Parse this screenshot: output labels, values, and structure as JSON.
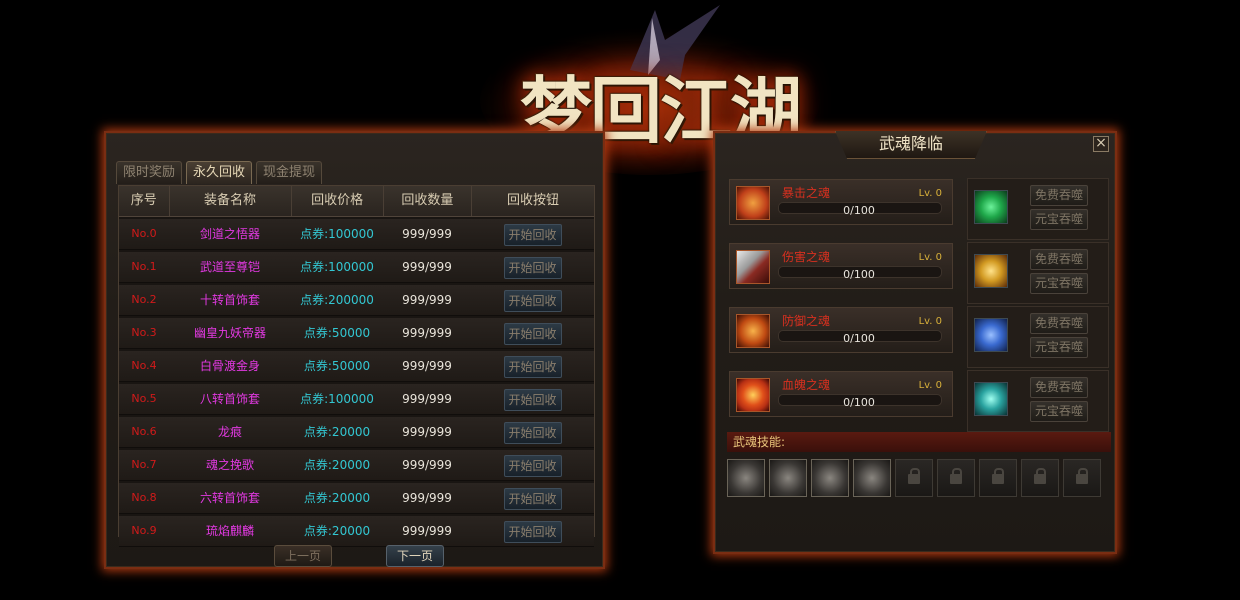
{
  "logo": {
    "text": "梦回江湖"
  },
  "left_panel": {
    "tabs": [
      {
        "label": "限时奖励",
        "active": false
      },
      {
        "label": "永久回收",
        "active": true
      },
      {
        "label": "现金提现",
        "active": false
      }
    ],
    "columns": [
      "序号",
      "装备名称",
      "回收价格",
      "回收数量",
      "回收按钮"
    ],
    "rows": [
      {
        "no": "No.0",
        "name": "剑道之悟器",
        "price": "点券:100000",
        "qty": "999/999",
        "button": "开始回收"
      },
      {
        "no": "No.1",
        "name": "武道至尊铠",
        "price": "点券:100000",
        "qty": "999/999",
        "button": "开始回收"
      },
      {
        "no": "No.2",
        "name": "十转首饰套",
        "price": "点券:200000",
        "qty": "999/999",
        "button": "开始回收"
      },
      {
        "no": "No.3",
        "name": "幽皇九妖帝器",
        "price": "点券:50000",
        "qty": "999/999",
        "button": "开始回收"
      },
      {
        "no": "No.4",
        "name": "白骨渡金身",
        "price": "点券:50000",
        "qty": "999/999",
        "button": "开始回收"
      },
      {
        "no": "No.5",
        "name": "八转首饰套",
        "price": "点券:100000",
        "qty": "999/999",
        "button": "开始回收"
      },
      {
        "no": "No.6",
        "name": "龙痕",
        "price": "点券:20000",
        "qty": "999/999",
        "button": "开始回收"
      },
      {
        "no": "No.7",
        "name": "魂之挽歌",
        "price": "点券:20000",
        "qty": "999/999",
        "button": "开始回收"
      },
      {
        "no": "No.8",
        "name": "六转首饰套",
        "price": "点券:20000",
        "qty": "999/999",
        "button": "开始回收"
      },
      {
        "no": "No.9",
        "name": "琉焰麒麟",
        "price": "点券:20000",
        "qty": "999/999",
        "button": "开始回收"
      }
    ],
    "prev_label": "上一页",
    "next_label": "下一页"
  },
  "right_panel": {
    "title": "武魂降临",
    "close": "×",
    "souls": [
      {
        "name": "暴击之魂",
        "level": "Lv. 0",
        "progress": "0/100",
        "icon": "crit-soul-icon",
        "color": "#c0401a"
      },
      {
        "name": "伤害之魂",
        "level": "Lv. 0",
        "progress": "0/100",
        "icon": "damage-soul-icon",
        "color": "#8a2a22"
      },
      {
        "name": "防御之魂",
        "level": "Lv. 0",
        "progress": "0/100",
        "icon": "defense-soul-icon",
        "color": "#c04a12"
      },
      {
        "name": "血魄之魂",
        "level": "Lv. 0",
        "progress": "0/100",
        "icon": "blood-soul-icon",
        "color": "#b83014"
      }
    ],
    "side_items": [
      {
        "icon": "green-orb-icon",
        "color": "#1fa84a",
        "free_label": "免费吞噬",
        "gold_label": "元宝吞噬"
      },
      {
        "icon": "gold-bead-icon",
        "color": "#d29a22",
        "free_label": "免费吞噬",
        "gold_label": "元宝吞噬"
      },
      {
        "icon": "blue-crystal-icon",
        "color": "#3a6ad0",
        "free_label": "免费吞噬",
        "gold_label": "元宝吞噬"
      },
      {
        "icon": "teal-swirl-icon",
        "color": "#2aa3a0",
        "free_label": "免费吞噬",
        "gold_label": "元宝吞噬"
      }
    ],
    "skills_label": "武魂技能:"
  }
}
